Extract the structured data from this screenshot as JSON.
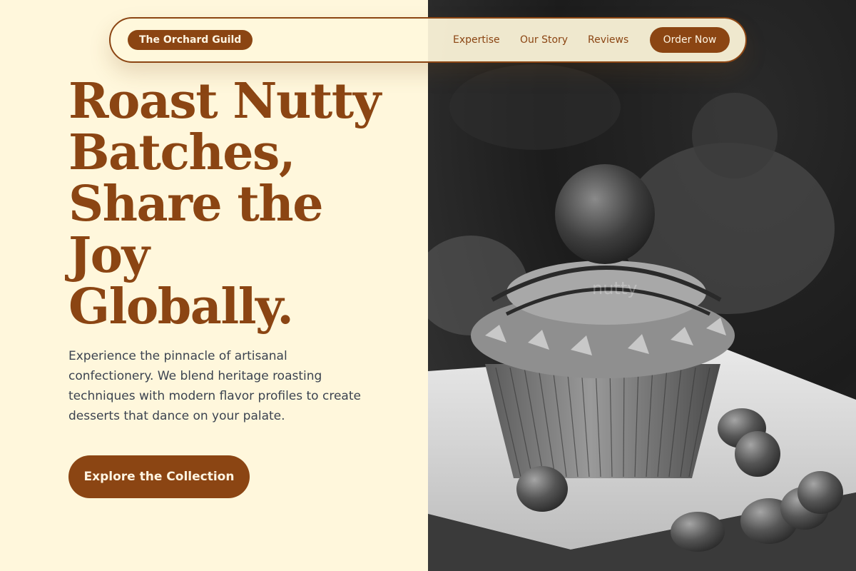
{
  "nav": {
    "brand": "The Orchard Guild",
    "links": [
      "Expertise",
      "Our Story",
      "Reviews"
    ],
    "order_label": "Order Now"
  },
  "hero": {
    "headline_lines": [
      "Roast Nutty",
      "Batches,",
      "Share the",
      "Joy",
      "Globally."
    ],
    "description": "Experience the pinnacle of artisanal confectionery. We blend heritage roasting techniques with modern flavor profiles to create desserts that dance on your palate.",
    "cta_label": "Explore the Collection"
  },
  "image": {
    "caption": "nutty",
    "alt": "cupcake with hazelnuts"
  },
  "colors": {
    "accent": "#8b4513",
    "background": "#fff7dc",
    "text": "#3b4350"
  }
}
